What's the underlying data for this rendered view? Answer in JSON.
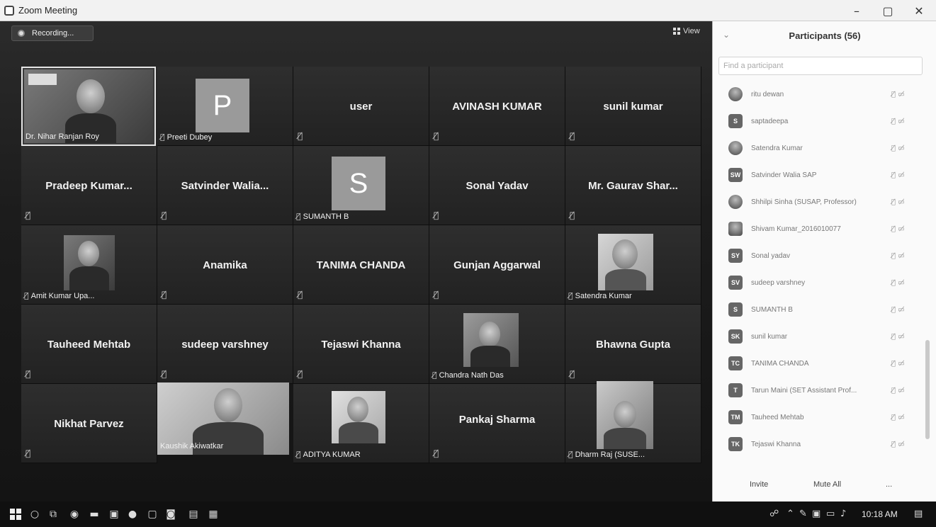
{
  "window": {
    "title": "Zoom Meeting"
  },
  "video": {
    "recording_label": "Recording...",
    "view_label": "View",
    "tiles": [
      {
        "name": "Dr. Nihar Ranjan Roy"
      },
      {
        "name": "Preeti Dubey",
        "letter": "P"
      },
      {
        "name": "user"
      },
      {
        "name": "AVINASH KUMAR"
      },
      {
        "name": "sunil kumar"
      },
      {
        "name": "Pradeep Kumar..."
      },
      {
        "name": "Satvinder Walia..."
      },
      {
        "name": "SUMANTH B",
        "letter": "S"
      },
      {
        "name": "Sonal Yadav"
      },
      {
        "name": "Mr. Gaurav Shar..."
      },
      {
        "name": "Amit Kumar Upa..."
      },
      {
        "name": "Anamika"
      },
      {
        "name": "TANIMA CHANDA"
      },
      {
        "name": "Gunjan Aggarwal"
      },
      {
        "name": "Satendra Kumar"
      },
      {
        "name": "Tauheed Mehtab"
      },
      {
        "name": "sudeep varshney"
      },
      {
        "name": "Tejaswi Khanna"
      },
      {
        "name": "Chandra Nath Das"
      },
      {
        "name": "Bhawna Gupta"
      },
      {
        "name": "Nikhat Parvez"
      },
      {
        "name": "Kaushik Akiwatkar"
      },
      {
        "name": "ADITYA KUMAR"
      },
      {
        "name": "Pankaj Sharma"
      },
      {
        "name": "Dharm Raj (SUSE..."
      }
    ]
  },
  "participants": {
    "header": "Participants (56)",
    "search_placeholder": "Find a participant",
    "items": [
      {
        "initials": "",
        "name": "ritu dewan"
      },
      {
        "initials": "S",
        "name": "saptadeepa"
      },
      {
        "initials": "",
        "name": "Satendra Kumar"
      },
      {
        "initials": "SW",
        "name": "Satvinder Walia SAP"
      },
      {
        "initials": "",
        "name": "Shhilpi Sinha (SUSAP, Professor)"
      },
      {
        "initials": "",
        "name": "Shivam Kumar_2016010077"
      },
      {
        "initials": "SY",
        "name": "Sonal yadav"
      },
      {
        "initials": "SV",
        "name": "sudeep varshney"
      },
      {
        "initials": "S",
        "name": "SUMANTH B"
      },
      {
        "initials": "SK",
        "name": "sunil kumar"
      },
      {
        "initials": "TC",
        "name": "TANIMA CHANDA"
      },
      {
        "initials": "T",
        "name": "Tarun Maini (SET Assistant Prof..."
      },
      {
        "initials": "TM",
        "name": "Tauheed Mehtab"
      },
      {
        "initials": "TK",
        "name": "Tejaswi Khanna"
      }
    ],
    "invite_label": "Invite",
    "mute_all_label": "Mute All",
    "more_label": "..."
  },
  "taskbar": {
    "clock": "10:18 AM"
  }
}
